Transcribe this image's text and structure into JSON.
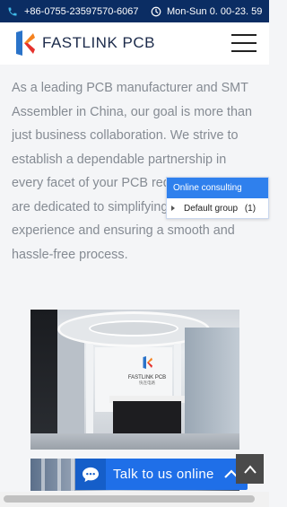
{
  "topbar": {
    "phone": "+86-0755-23597570-6067",
    "hours": "Mon-Sun 0. 00-23. 59"
  },
  "header": {
    "brand": "FASTLINK PCB"
  },
  "intro": {
    "text": "As a leading PCB manufacturer and SMT Assembler in China, our goal is more than just business collaboration. We strive to establish a dependable partnership in every facet of your PCB requirements. We are dedicated to simplifying your experience and ensuring a smooth and hassle-free process."
  },
  "chat_widget": {
    "title": "Online consulting",
    "group_label": "Default group",
    "group_count": "(1)"
  },
  "office_photo": {
    "brand": "FASTLINK PCB",
    "chinese": "快连电路"
  },
  "talk_bar": {
    "label": "Talk to us online"
  },
  "colors": {
    "topbar": "#0b2d63",
    "accent_blue": "#1f6fe8",
    "logo_orange": "#f5821f",
    "logo_red": "#e5322d",
    "logo_blue": "#2a73c9",
    "phone_icon": "#3fb8e6",
    "body_text": "#858b93"
  },
  "icons": [
    "phone-icon",
    "clock-icon",
    "logo-mark",
    "hamburger-menu-icon",
    "caret-right-icon",
    "chat-bubble-icon",
    "chevron-up-icon"
  ]
}
